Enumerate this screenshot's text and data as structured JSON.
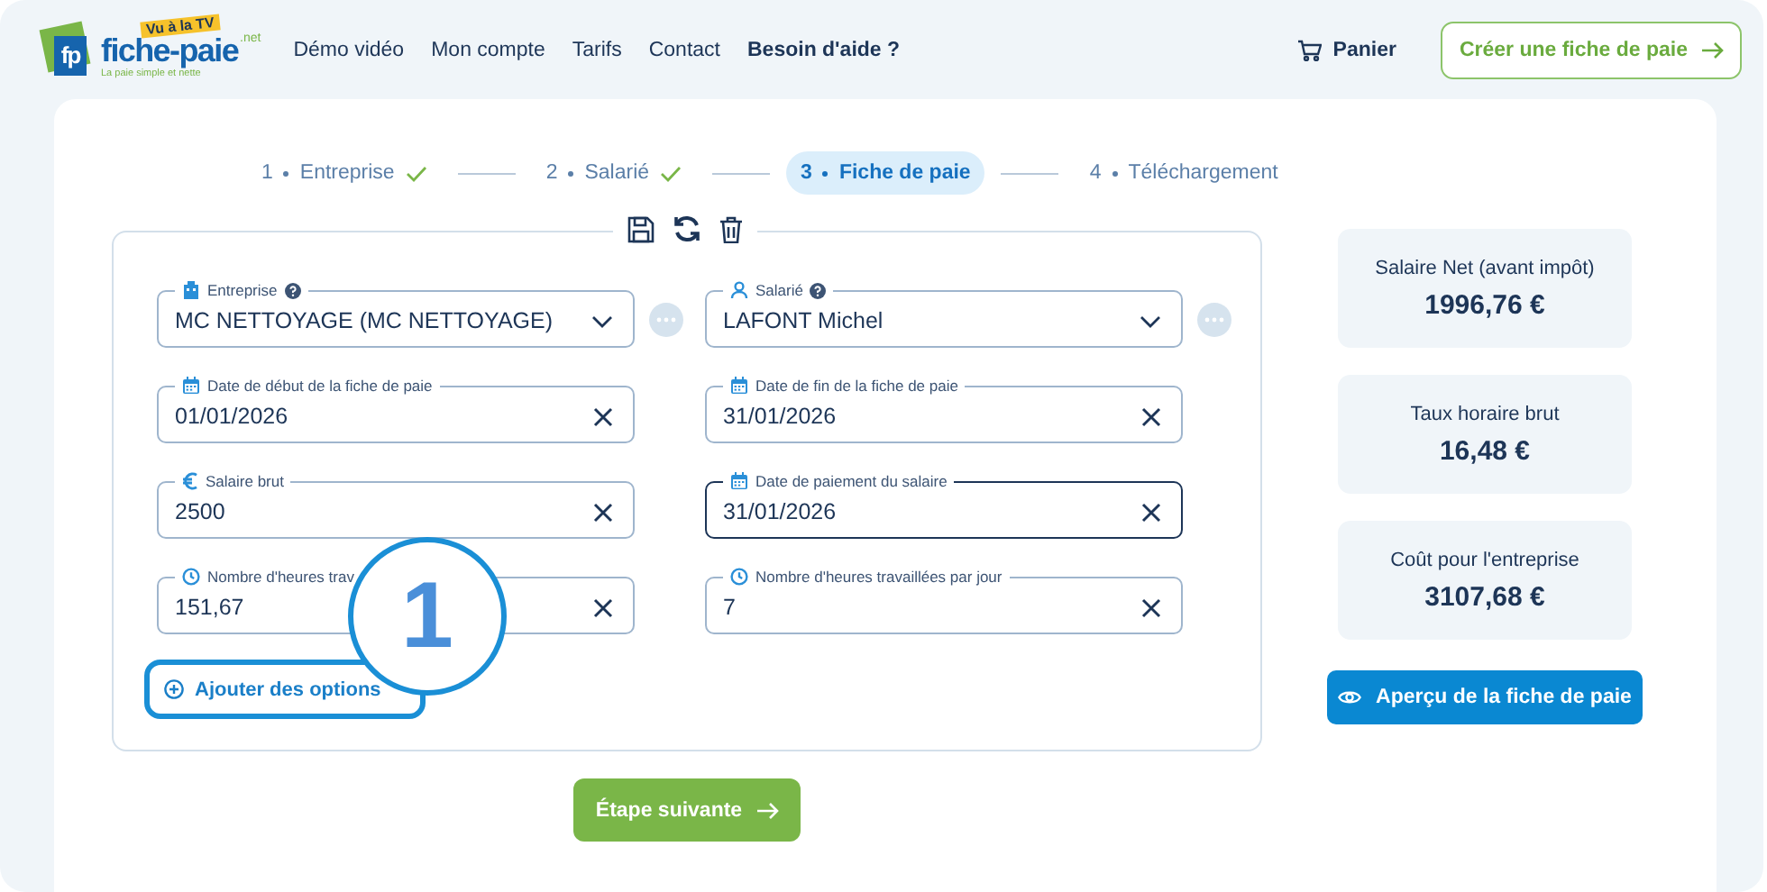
{
  "header": {
    "logo": {
      "monogram": "fp",
      "name": "fiche-paie",
      "suffix": ".net",
      "badge": "Vu à la TV",
      "tagline": "La paie simple et nette"
    },
    "nav": [
      {
        "label": "Démo vidéo",
        "bold": false
      },
      {
        "label": "Mon compte",
        "bold": false
      },
      {
        "label": "Tarifs",
        "bold": false
      },
      {
        "label": "Contact",
        "bold": false
      },
      {
        "label": "Besoin d'aide ?",
        "bold": true
      }
    ],
    "cart": "Panier",
    "cta": "Créer une fiche de paie"
  },
  "steps": [
    {
      "number": "1",
      "label": "Entreprise",
      "done": true,
      "selected": false
    },
    {
      "number": "2",
      "label": "Salarié",
      "done": true,
      "selected": false
    },
    {
      "number": "3",
      "label": "Fiche de paie",
      "done": false,
      "selected": true
    },
    {
      "number": "4",
      "label": "Téléchargement",
      "done": false,
      "selected": false
    }
  ],
  "fields": [
    {
      "kind": "select",
      "label": "Entreprise",
      "help": true,
      "value": "MC NETTOYAGE (MC NETTOYAGE)",
      "more": true,
      "focused": false
    },
    {
      "kind": "select",
      "label": "Salarié",
      "help": true,
      "value": "LAFONT Michel",
      "more": true,
      "focused": false
    },
    {
      "kind": "text",
      "label": "Date de début de la fiche de paie",
      "value": "01/01/2026",
      "focused": false
    },
    {
      "kind": "text",
      "label": "Date de fin de la fiche de paie",
      "value": "31/01/2026",
      "focused": false
    },
    {
      "kind": "text",
      "label": "Salaire brut",
      "value": "2500",
      "focused": false
    },
    {
      "kind": "text",
      "label": "Date de paiement du salaire",
      "value": "31/01/2026",
      "focused": true
    },
    {
      "kind": "text",
      "label": "Nombre d'heures trav",
      "value": "151,67",
      "focused": false
    },
    {
      "kind": "text",
      "label": "Nombre d'heures travaillées par jour",
      "value": "7",
      "focused": false
    }
  ],
  "add_options": "Ajouter des options",
  "annotation": "1",
  "next_button": "Étape suivante",
  "summary": [
    {
      "label": "Salaire Net (avant impôt)",
      "value": "1996,76 €"
    },
    {
      "label": "Taux horaire brut",
      "value": "16,48 €"
    },
    {
      "label": "Coût pour l'entreprise",
      "value": "3107,68 €"
    }
  ],
  "preview_button": "Aperçu de la fiche de paie"
}
